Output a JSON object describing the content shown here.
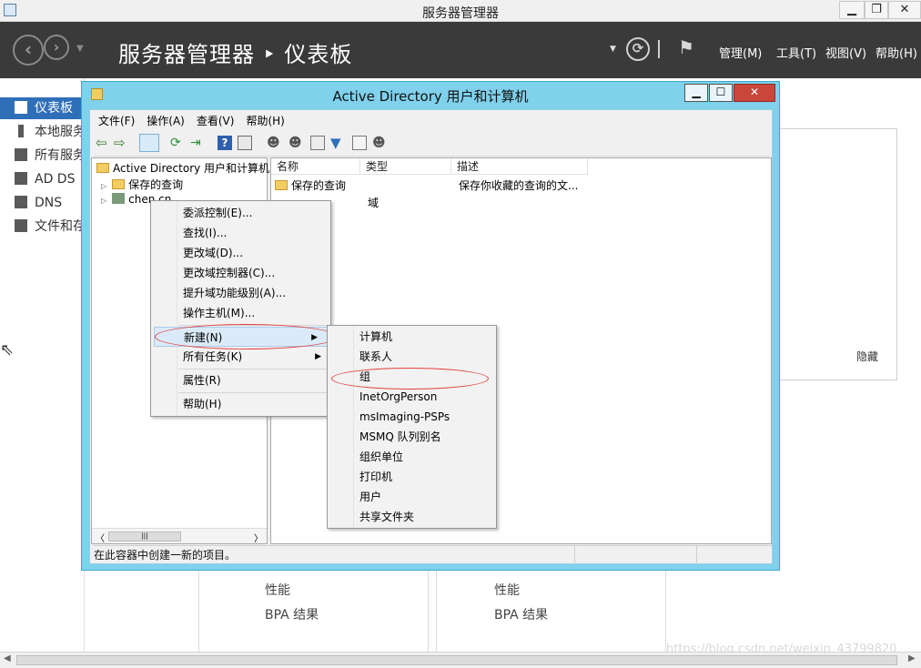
{
  "server_manager": {
    "window_title": "服务器管理器",
    "breadcrumb": "服务器管理器 ‣ 仪表板",
    "menus": [
      "管理(M)",
      "工具(T)",
      "视图(V)",
      "帮助(H)"
    ],
    "nav_items": [
      "仪表板",
      "本地服务",
      "所有服务",
      "AD DS",
      "DNS",
      "文件和存"
    ],
    "right_panel_label": "隐藏",
    "cards": [
      {
        "line1": "性能",
        "line2": "BPA 结果"
      },
      {
        "line1": "性能",
        "line2": "BPA 结果"
      }
    ],
    "watermark": "https://blog.csdn.net/weixin_43799820"
  },
  "aduc": {
    "title": "Active Directory 用户和计算机",
    "menu": [
      "文件(F)",
      "操作(A)",
      "查看(V)",
      "帮助(H)"
    ],
    "tree": {
      "root": "Active Directory 用户和计算机",
      "saved_queries": "保存的查询",
      "domain": "chen.cn"
    },
    "columns": [
      "名称",
      "类型",
      "描述"
    ],
    "rows": [
      {
        "name": "保存的查询",
        "type": "",
        "desc": "保存你收藏的查询的文..."
      },
      {
        "name": "",
        "type": "域",
        "desc": ""
      }
    ],
    "status": "在此容器中创建一新的项目。"
  },
  "context_menu": {
    "items": [
      "委派控制(E)...",
      "查找(I)...",
      "更改域(D)...",
      "更改域控制器(C)...",
      "提升域功能级别(A)...",
      "操作主机(M)...",
      "新建(N)",
      "所有任务(K)",
      "属性(R)",
      "帮助(H)"
    ]
  },
  "submenu": {
    "items": [
      "计算机",
      "联系人",
      "组",
      "InetOrgPerson",
      "msImaging-PSPs",
      "MSMQ 队列别名",
      "组织单位",
      "打印机",
      "用户",
      "共享文件夹"
    ]
  },
  "colors": {
    "accent": "#2f6fb8",
    "aduc_frame": "#7fd1ec",
    "highlight_oval": "#e0413a"
  }
}
